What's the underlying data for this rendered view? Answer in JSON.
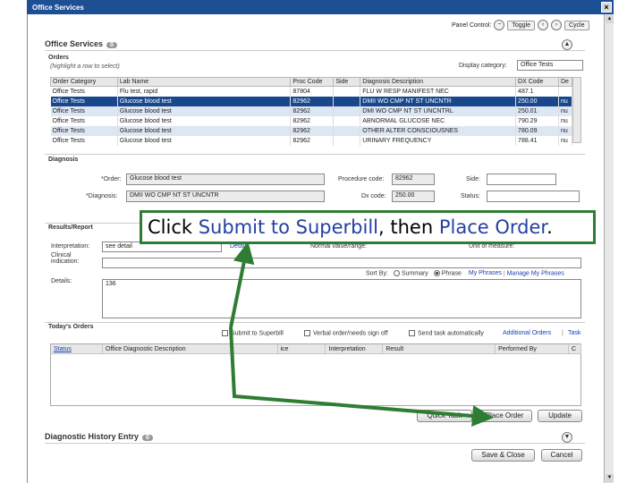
{
  "window": {
    "title": "Office Services"
  },
  "panel_control": {
    "label": "Panel Control:",
    "toggle": "Toggle",
    "cycle": "Cycle"
  },
  "office_services": {
    "title": "Office Services",
    "count": "0"
  },
  "orders": {
    "title": "Orders",
    "hint": "(highlight a row to select)",
    "display_category_label": "Display category:",
    "display_category_value": "Office Tests",
    "columns": [
      "Order Category",
      "Lab Name",
      "Proc Code",
      "Side",
      "Diagnosis Description",
      "DX Code",
      "De"
    ],
    "rows": [
      [
        "Office Tests",
        "Flu test, rapid",
        "87804",
        "",
        "FLU W RESP MANIFEST NEC",
        "487.1",
        ""
      ],
      [
        "Office Tests",
        "Glucose blood test",
        "82962",
        "",
        "DMII WO CMP NT ST UNCNTR",
        "250.00",
        "nu"
      ],
      [
        "Office Tests",
        "Glucose blood test",
        "82962",
        "",
        "DMI WO CMP NT ST UNCNTRL",
        "250.01",
        "nu"
      ],
      [
        "Office Tests",
        "Glucose blood test",
        "82962",
        "",
        "ABNORMAL GLUCOSE NEC",
        "790.29",
        "nu"
      ],
      [
        "Office Tests",
        "Glucose blood test",
        "82962",
        "",
        "OTHER ALTER CONSCIOUSNES",
        "780.09",
        "nu"
      ],
      [
        "Office Tests",
        "Glucose blood test",
        "82962",
        "",
        "URINARY FREQUENCY",
        "788.41",
        "nu"
      ]
    ]
  },
  "diagnosis": {
    "title": "Diagnosis",
    "order_label": "*Order:",
    "order_value": "Glucose blood test",
    "procedure_code_label": "Procedure code:",
    "procedure_code_value": "82962",
    "side_label": "Side:",
    "diagnosis_label": "*Diagnosis:",
    "diagnosis_value": "DMII WO CMP NT ST UNCNTR",
    "dx_code_label": "Dx code:",
    "dx_code_value": "250.00",
    "status_label": "Status:"
  },
  "results": {
    "title": "Results/Report",
    "interpretation_label": "Interpretation:",
    "interpretation_value": "see detail",
    "detail_link": "Detail",
    "normal_label": "Normal value/range:",
    "unit_label": "Unit of measure:",
    "clinical_label": "Clinical indication:",
    "sort_label": "Sort By:",
    "sort_summary": "Summary",
    "sort_phrase": "Phrase",
    "my_phrases": "My Phrases",
    "manage_phrases": "Manage My Phrases",
    "details_label": "Details:",
    "details_value": "136"
  },
  "todays_orders": {
    "title": "Today's Orders",
    "submit_superbill": "Submit to Superbill",
    "verbal_order": "Verbal order/needs sign off",
    "send_task": "Send task automatically",
    "additional_orders": "Additional Orders",
    "task": "Task",
    "columns": [
      "Status",
      "Office Diagnostic Description",
      "ice",
      "Interpretation",
      "Result",
      "Performed By",
      "C"
    ]
  },
  "buttons": {
    "quick_task": "Quick Task",
    "place_order": "Place Order",
    "update": "Update",
    "save_close": "Save & Close",
    "cancel": "Cancel"
  },
  "diagnostic_history": {
    "title": "Diagnostic History Entry",
    "count": "0"
  },
  "callout": {
    "pre": "Click ",
    "submit": "Submit to Superbill",
    "mid": ", then ",
    "place": "Place Order",
    "end": "."
  },
  "colors": {
    "titlebar": "#1d4f94",
    "selected_row": "#19478c",
    "callout_border": "#2e7d32",
    "arrow": "#2e7d32"
  }
}
